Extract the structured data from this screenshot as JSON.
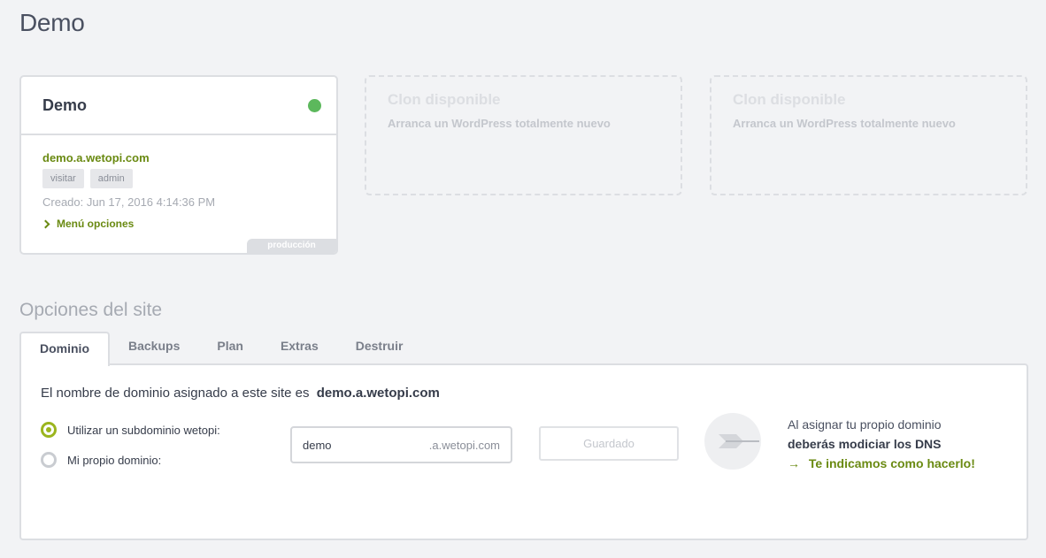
{
  "page": {
    "title": "Demo"
  },
  "site_card": {
    "name": "Demo",
    "domain": "demo.a.wetopi.com",
    "tags": [
      "visitar",
      "admin"
    ],
    "created": "Creado: Jun 17, 2016 4:14:36 PM",
    "menu_label": "Menú opciones",
    "environment_badge": "producción",
    "status_color": "#5cb85c"
  },
  "clones": [
    {
      "title": "Clon disponible",
      "subtitle": "Arranca un WordPress totalmente nuevo"
    },
    {
      "title": "Clon disponible",
      "subtitle": "Arranca un WordPress totalmente nuevo"
    }
  ],
  "options": {
    "title": "Opciones del site",
    "tabs": [
      "Dominio",
      "Backups",
      "Plan",
      "Extras",
      "Destruir"
    ],
    "active_tab": "Dominio"
  },
  "domain_panel": {
    "assigned_text": "El nombre de dominio asignado a este site es",
    "assigned_domain": "demo.a.wetopi.com",
    "radio_subdomain": "Utilizar un subdominio wetopi:",
    "radio_own": "Mi propio dominio:",
    "selected": "subdomain",
    "subdomain_value": "demo",
    "subdomain_suffix": ".a.wetopi.com",
    "save_label": "Guardado",
    "dns_line1": "Al asignar tu propio dominio",
    "dns_line2": "deberás modiciar los DNS",
    "dns_arrow": "→",
    "dns_link": "Te indicamos como hacerlo!"
  },
  "colors": {
    "accent": "#9bb51e",
    "link": "#6a8a12",
    "status_ok": "#5cb85c"
  }
}
